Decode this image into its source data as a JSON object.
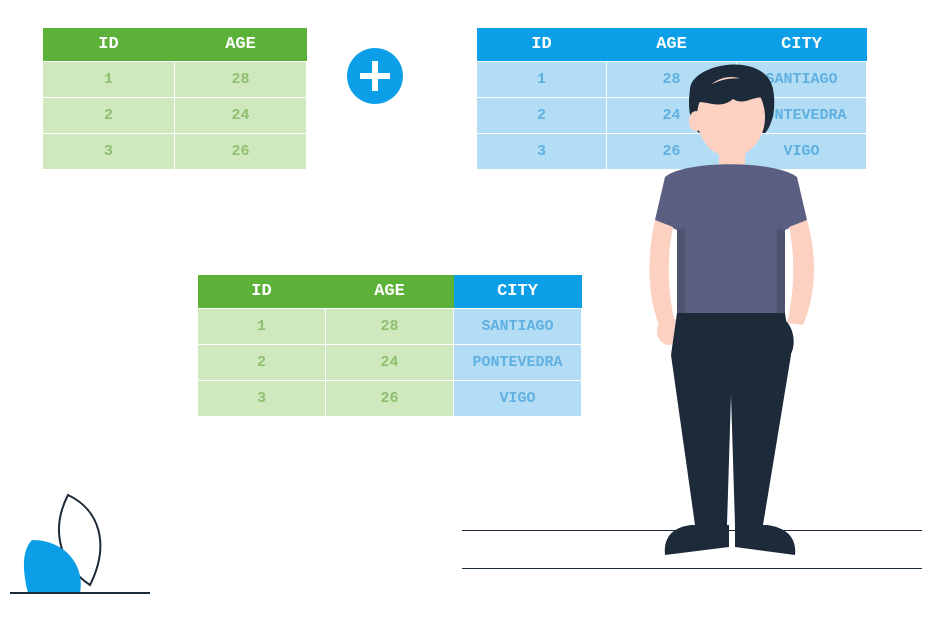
{
  "colors": {
    "green_header": "#5cb238",
    "green_cell": "#d0e8be",
    "blue_header": "#0c9fe8",
    "blue_cell": "#b2ddf5"
  },
  "tables": {
    "left_green": {
      "headers": [
        "ID",
        "AGE"
      ],
      "rows": [
        {
          "id": "1",
          "age": "28"
        },
        {
          "id": "2",
          "age": "24"
        },
        {
          "id": "3",
          "age": "26"
        }
      ]
    },
    "right_blue": {
      "headers": [
        "ID",
        "AGE",
        "CITY"
      ],
      "rows": [
        {
          "id": "1",
          "age": "28",
          "city": "SANTIAGO"
        },
        {
          "id": "2",
          "age": "24",
          "city": "PONTEVEDRA"
        },
        {
          "id": "3",
          "age": "26",
          "city": "VIGO"
        }
      ]
    },
    "merged": {
      "headers": [
        "ID",
        "AGE",
        "CITY"
      ],
      "rows": [
        {
          "id": "1",
          "age": "28",
          "city": "SANTIAGO"
        },
        {
          "id": "2",
          "age": "24",
          "city": "PONTEVEDRA"
        },
        {
          "id": "3",
          "age": "26",
          "city": "VIGO"
        }
      ]
    }
  },
  "icons": {
    "plus": "plus-icon",
    "leaf": "leaf-decoration",
    "person": "person-illustration"
  }
}
